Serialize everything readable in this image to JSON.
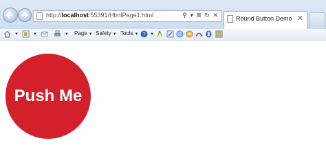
{
  "address_bar": {
    "url_prefix": "http://",
    "url_host": "localhost",
    "url_rest": ":55391/HtmlPage1.html",
    "controls": "⚲ ▾ ≣ ↻ ✕"
  },
  "tab": {
    "title": "Round Button Demo",
    "close": "✕"
  },
  "command_bar": {
    "page_label": "Page",
    "safety_label": "Safety",
    "tools_label": "Tools"
  },
  "content": {
    "round_button_label": "Push Me"
  },
  "colors": {
    "button_red": "#d3202b",
    "button_text": "#ffffff"
  }
}
